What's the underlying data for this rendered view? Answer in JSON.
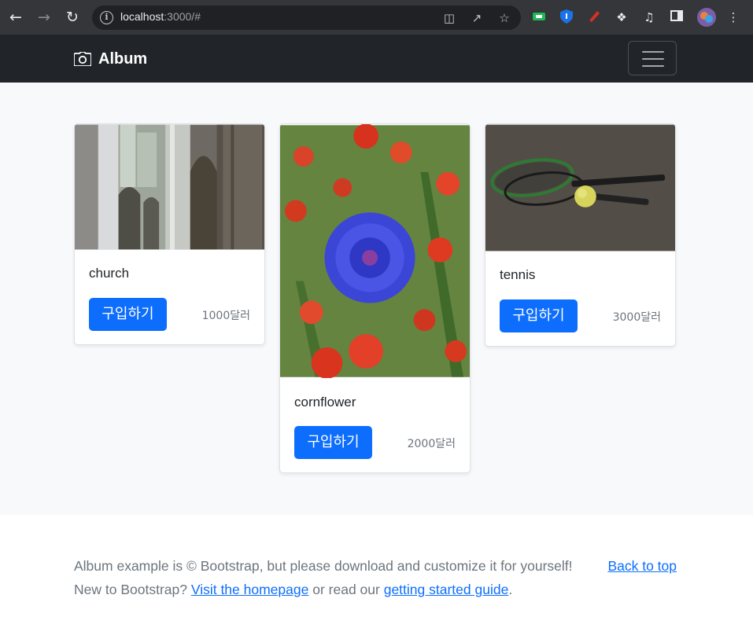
{
  "browser": {
    "url_host": "localhost",
    "url_path": ":3000/#"
  },
  "navbar": {
    "brand": "Album",
    "brand_icon": "camera-icon",
    "toggler_icon": "hamburger-icon"
  },
  "cards": [
    {
      "title": "church",
      "button": "구입하기",
      "price": "1000달러"
    },
    {
      "title": "cornflower",
      "button": "구입하기",
      "price": "2000달러"
    },
    {
      "title": "tennis",
      "button": "구입하기",
      "price": "3000달러"
    }
  ],
  "footer": {
    "line1": "Album example is © Bootstrap, but please download and customize it for yourself!",
    "back_to_top": "Back to top",
    "line2_prefix": "New to Bootstrap?",
    "homepage_link": "Visit the homepage",
    "line2_middle": "or read our",
    "guide_link": "getting started guide",
    "line2_suffix": "."
  },
  "colors": {
    "primary": "#0d6efd",
    "navbar": "#212529",
    "album_bg": "#f8f9fa",
    "muted": "#6c757d"
  }
}
